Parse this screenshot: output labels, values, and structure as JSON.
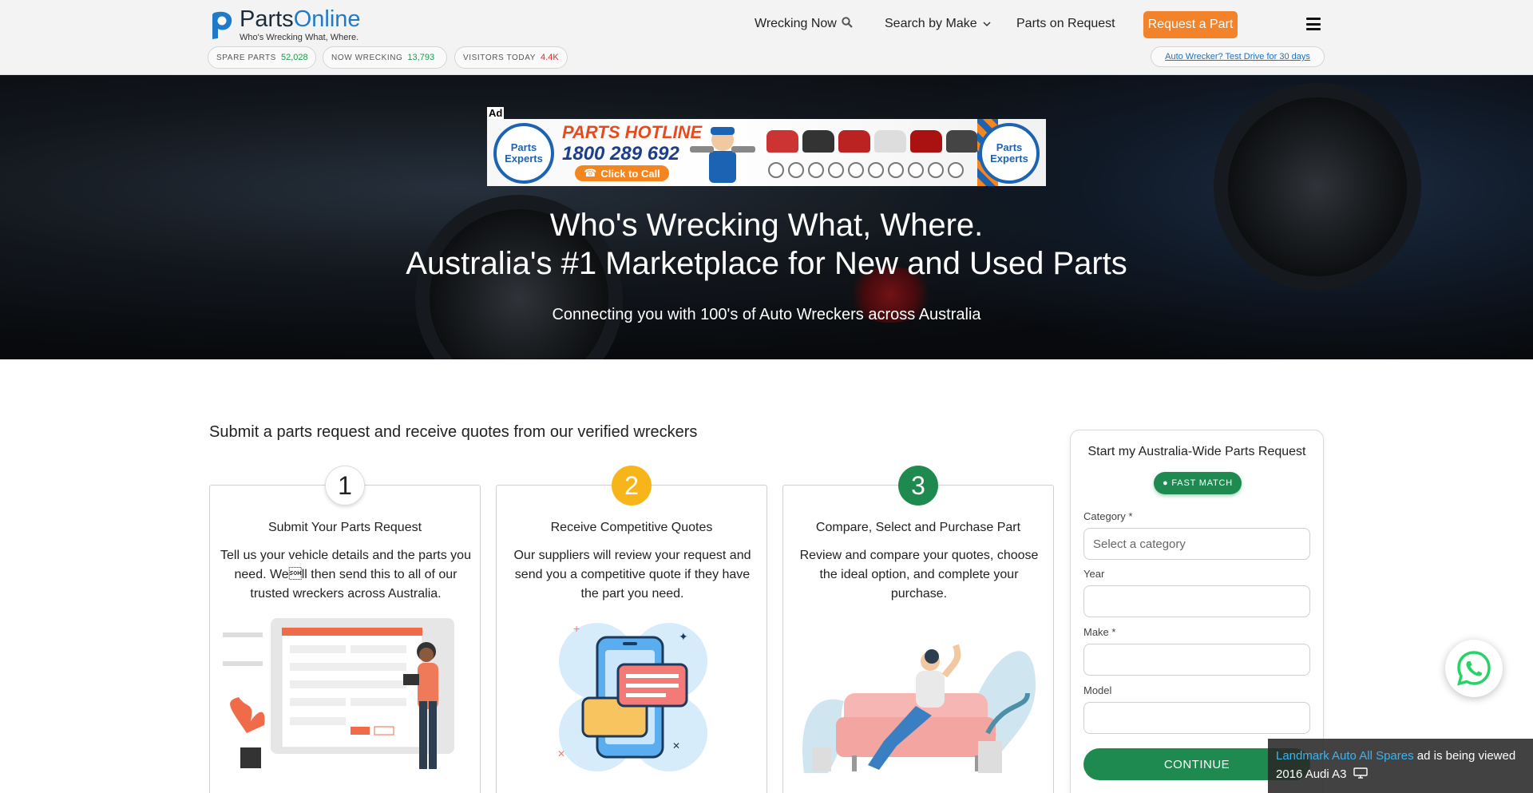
{
  "brand": {
    "name_part1": "Parts",
    "name_part2": "Online",
    "tagline": "Who's Wrecking What, Where."
  },
  "nav": {
    "wrecking_now": "Wrecking Now",
    "search_by_make": "Search by Make",
    "parts_on_request": "Parts on Request",
    "request_part": "Request a Part"
  },
  "stats": [
    {
      "label": "SPARE PARTS",
      "value": "52,028"
    },
    {
      "label": "NOW WRECKING",
      "value": "13,793"
    },
    {
      "label": "VISITORS TODAY",
      "value": "4.4K"
    }
  ],
  "promo_link": "Auto Wrecker? Test Drive for 30 days",
  "ad": {
    "tag": "Ad",
    "hotline": "PARTS HOTLINE",
    "phone": "1800 289 692",
    "call": "Click to Call",
    "badge": "Parts Experts"
  },
  "hero": {
    "line1": "Who's Wrecking What, Where.",
    "line2": "Australia's #1 Marketplace for New and Used Parts",
    "subtitle": "Connecting you with 100's of Auto Wreckers across Australia"
  },
  "section_title": "Submit a parts request and receive quotes from our verified wreckers",
  "steps": [
    {
      "number": "1",
      "title": "Submit Your Parts Request",
      "text": "Tell us your vehicle details and the parts you need. We\u0001ll then send this to all of our trusted wreckers across Australia."
    },
    {
      "number": "2",
      "title": "Receive Competitive Quotes",
      "text": "Our suppliers will review your request and send you a competitive quote if they have the part you need."
    },
    {
      "number": "3",
      "title": "Compare, Select and Purchase Part",
      "text": "Review and compare your quotes, choose the ideal option, and complete your purchase."
    }
  ],
  "form": {
    "title": "Start my Australia-Wide Parts Request",
    "badge": "FAST MATCH",
    "category_label": "Category *",
    "category_placeholder": "Select a category",
    "year_label": "Year",
    "make_label": "Make *",
    "model_label": "Model",
    "submit": "CONTINUE"
  },
  "toast": {
    "link": "Landmark Auto All Spares",
    "text": "ad is being viewed",
    "vehicle": "2016 Audi A3"
  },
  "colors": {
    "brand_blue": "#1f7ac9",
    "accent_orange": "#f2832a",
    "green": "#1e8a4f",
    "yellow": "#f7b519"
  }
}
